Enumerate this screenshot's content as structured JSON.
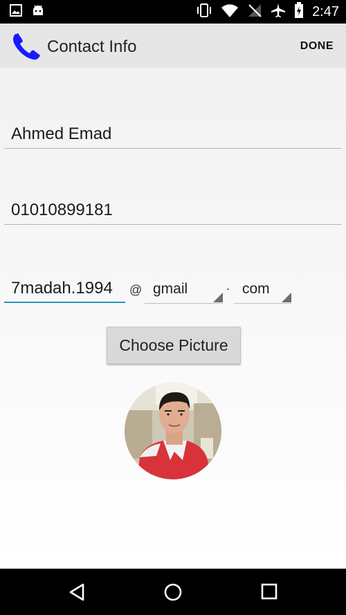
{
  "status_bar": {
    "time": "2:47",
    "icons": [
      "image-icon",
      "android-icon",
      "vibrate-icon",
      "wifi-icon",
      "no-signal-icon",
      "airplane-icon",
      "battery-charging-icon"
    ]
  },
  "action_bar": {
    "title": "Contact Info",
    "done_label": "DONE",
    "app_icon": "phone-icon",
    "icon_color": "#1a1aff"
  },
  "form": {
    "name_value": "Ahmed Emad",
    "phone_value": "01010899181",
    "email_user_value": "7madah.1994",
    "at_symbol": "@",
    "domain_selected": "gmail",
    "dot_symbol": ".",
    "tld_selected": "com",
    "accent_color": "#2a8fc2"
  },
  "choose_picture_label": "Choose Picture",
  "nav_bar": {
    "icons": [
      "back-icon",
      "home-icon",
      "recents-icon"
    ]
  }
}
